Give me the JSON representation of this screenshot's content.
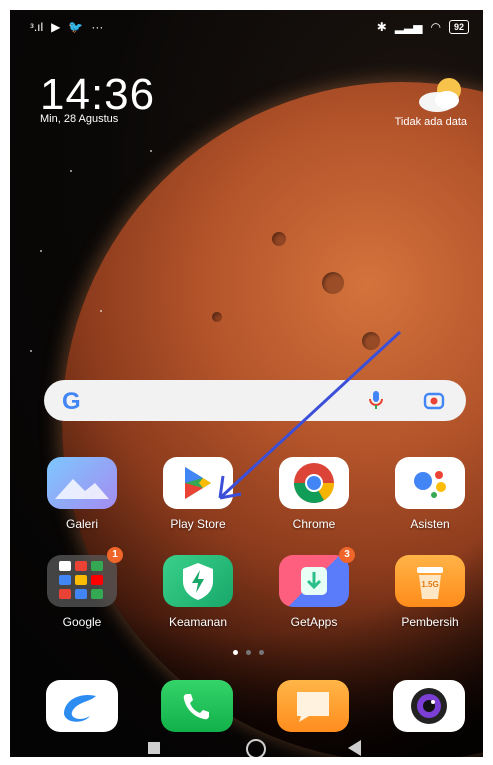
{
  "status_bar": {
    "left_signal": "ᵌ.ıl",
    "right_icons": [
      "bluetooth-icon",
      "signal-icon",
      "wifi-icon"
    ],
    "battery": "92"
  },
  "lockclock": {
    "time": "14:36",
    "date": "Min, 28 Agustus"
  },
  "weather": {
    "text": "Tidak ada data",
    "icon": "cloud-sun-icon"
  },
  "search": {
    "logo": "G"
  },
  "apps_row1": [
    {
      "label": "Galeri",
      "icon": "gallery-icon"
    },
    {
      "label": "Play Store",
      "icon": "play-store-icon"
    },
    {
      "label": "Chrome",
      "icon": "chrome-icon"
    },
    {
      "label": "Asisten",
      "icon": "assistant-icon"
    }
  ],
  "apps_row2": [
    {
      "label": "Google",
      "icon": "google-folder-icon",
      "badge": "1"
    },
    {
      "label": "Keamanan",
      "icon": "security-icon"
    },
    {
      "label": "GetApps",
      "icon": "getapps-icon",
      "badge": "3"
    },
    {
      "label": "Pembersih",
      "icon": "cleaner-icon",
      "icon_text": "1.5G"
    }
  ],
  "dock": [
    "browser-icon",
    "phone-icon",
    "messages-icon",
    "camera-icon"
  ],
  "page_indicator": {
    "count": 3,
    "active": 0
  },
  "colors": {
    "arrow": "#3b4fd8",
    "badge": "#f0652a"
  }
}
